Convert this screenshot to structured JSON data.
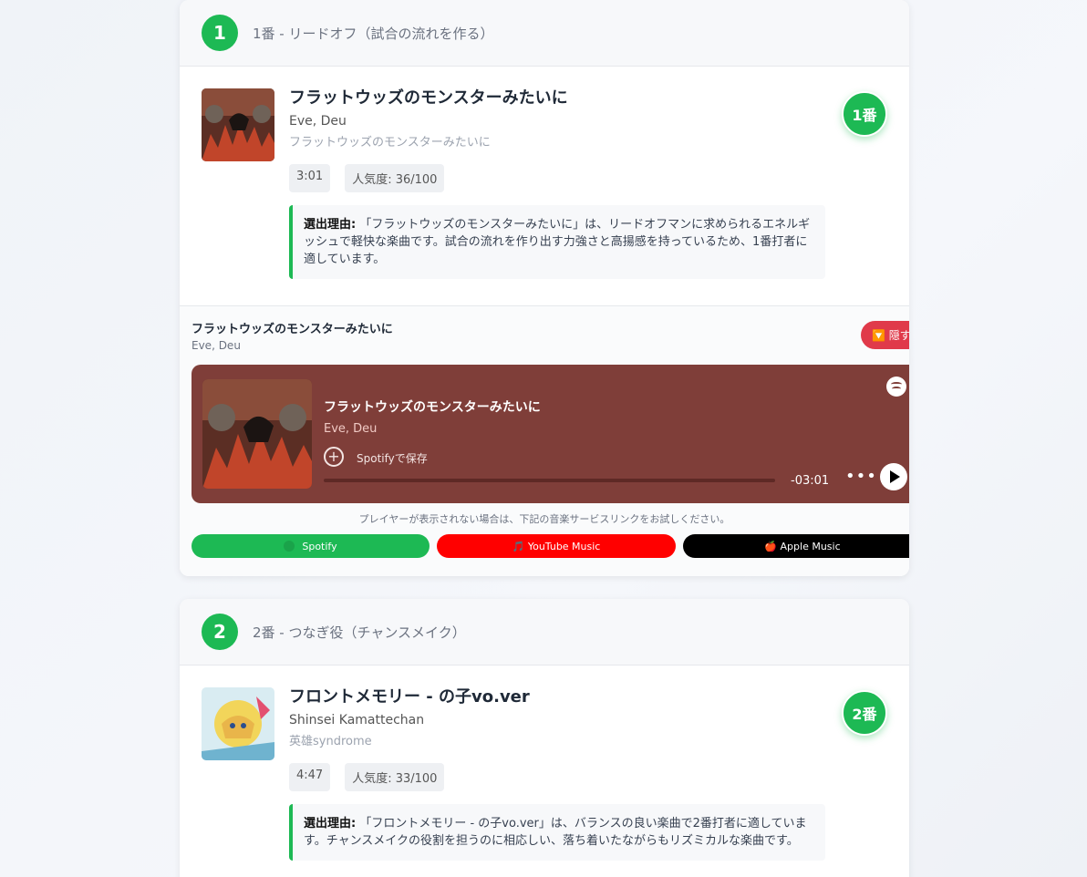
{
  "slots": [
    {
      "order": "1",
      "header_title": "1番 - リードオフ（試合の流れを作る）",
      "song_title": "フラットウッズのモンスターみたいに",
      "artist": "Eve, Deu",
      "album": "フラットウッズのモンスターみたいに",
      "duration": "3:01",
      "popularity": "人気度: 36/100",
      "reason_label": "選出理由:",
      "reason_text": "「フラットウッズのモンスターみたいに」は、リードオフマンに求められるエネルギッシュで軽快な楽曲です。試合の流れを作り出す力強さと高揚感を持っているため、1番打者に適しています。",
      "badge": "1番"
    },
    {
      "order": "2",
      "header_title": "2番 - つなぎ役（チャンスメイク）",
      "song_title": "フロントメモリー - の子vo.ver",
      "artist": "Shinsei Kamattechan",
      "album": "英雄syndrome",
      "duration": "4:47",
      "popularity": "人気度: 33/100",
      "reason_label": "選出理由:",
      "reason_text": "「フロントメモリー - の子vo.ver」は、バランスの良い楽曲で2番打者に適しています。チャンスメイクの役割を担うのに相応しい、落ち着いたながらもリズミカルな楽曲です。",
      "badge": "2番"
    }
  ],
  "player": {
    "title": "フラットウッズのモンスターみたいに",
    "artist": "Eve, Deu",
    "hide_label": "🔽 隠す",
    "embed_title": "フラットウッズのモンスターみたいに",
    "embed_artist": "Eve, Deu",
    "save_label": "Spotifyで保存",
    "time_remaining": "-03:01",
    "fallback_text": "プレイヤーが表示されない場合は、下記の音楽サービスリンクをお試しください。",
    "services": {
      "spotify": "Spotify",
      "youtube": "🎵 YouTube Music",
      "apple": "🍎 Apple Music"
    },
    "embed_color": "#7f3e39"
  },
  "colors": {
    "accent": "#1db954",
    "hide": "#e03a4a",
    "youtube": "#ff0000",
    "apple": "#000000"
  },
  "icons": [
    "spotify-logo-icon",
    "add-circle-icon",
    "more-icon",
    "play-icon"
  ]
}
